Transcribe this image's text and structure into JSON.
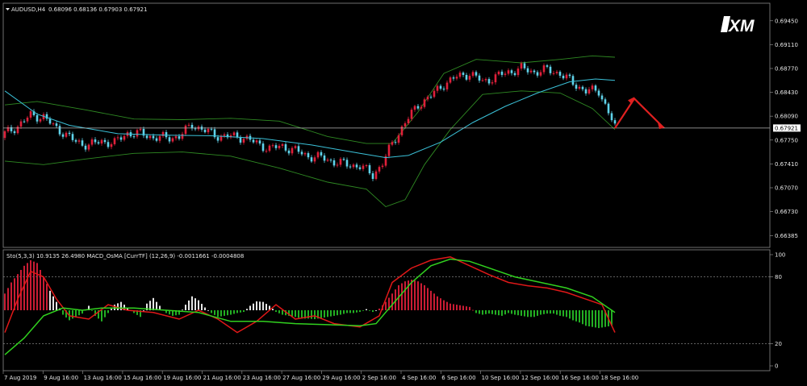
{
  "brand": {
    "logo_text": "XM"
  },
  "header": {
    "symbol_label": "AUDUSD,H4",
    "ohlc": "0.68096 0.68136 0.67903 0.67921"
  },
  "indicator_header": "Sto(5,3,3) 10.9135 26.4980  MACD_OsMA [CurrTF] (12,26,9) -0.0011661 -0.0004808",
  "colors": {
    "background": "#000000",
    "bull": "#e0203a",
    "bear": "#5fd2ea",
    "ma": "#3bc1d8",
    "bands": "#2f8a23",
    "arrow": "#e02020",
    "sto_main": "#e01818",
    "sto_signal": "#31d11f",
    "osma_pos": "#ffffff",
    "osma_neg": "#27c227"
  },
  "chart_data": [
    {
      "type": "candlestick",
      "title": "AUDUSD,H4",
      "ylim": [
        0.6622,
        0.697
      ],
      "y_ticks": [
        0.6945,
        0.6911,
        0.6877,
        0.6843,
        0.6809,
        0.6775,
        0.6741,
        0.6707,
        0.6673,
        0.66385
      ],
      "y_tick_labels": [
        "0.69450",
        "0.69110",
        "0.68770",
        "0.68430",
        "0.68090",
        "0.67750",
        "0.67410",
        "0.67070",
        "0.66730",
        "0.66385"
      ],
      "current_price": 0.67921,
      "current_price_label": "0.67921",
      "x_labels": [
        "7 Aug 2019",
        "9 Aug 16:00",
        "13 Aug 16:00",
        "15 Aug 16:00",
        "19 Aug 16:00",
        "21 Aug 16:00",
        "23 Aug 16:00",
        "27 Aug 16:00",
        "29 Aug 16:00",
        "2 Sep 16:00",
        "4 Sep 16:00",
        "6 Sep 16:00",
        "10 Sep 16:00",
        "12 Sep 16:00",
        "16 Sep 16:00",
        "18 Sep 16:00"
      ],
      "close_path": [
        [
          0,
          0.6784
        ],
        [
          4,
          0.6795
        ],
        [
          8,
          0.681
        ],
        [
          12,
          0.6808
        ],
        [
          15,
          0.6795
        ],
        [
          18,
          0.6786
        ],
        [
          22,
          0.6772
        ],
        [
          26,
          0.6768
        ],
        [
          30,
          0.6773
        ],
        [
          34,
          0.6771
        ],
        [
          38,
          0.6785
        ],
        [
          42,
          0.6784
        ],
        [
          46,
          0.6779
        ],
        [
          50,
          0.6778
        ],
        [
          54,
          0.678
        ],
        [
          58,
          0.6797
        ],
        [
          62,
          0.6788
        ],
        [
          66,
          0.6781
        ],
        [
          70,
          0.678
        ],
        [
          74,
          0.6779
        ],
        [
          78,
          0.677
        ],
        [
          82,
          0.6763
        ],
        [
          86,
          0.6766
        ],
        [
          90,
          0.676
        ],
        [
          94,
          0.6752
        ],
        [
          98,
          0.675
        ],
        [
          102,
          0.6744
        ],
        [
          106,
          0.674
        ],
        [
          110,
          0.6738
        ],
        [
          114,
          0.6725
        ],
        [
          117,
          0.6742
        ],
        [
          120,
          0.677
        ],
        [
          124,
          0.68
        ],
        [
          128,
          0.6825
        ],
        [
          132,
          0.6838
        ],
        [
          136,
          0.6855
        ],
        [
          140,
          0.6865
        ],
        [
          144,
          0.687
        ],
        [
          148,
          0.6858
        ],
        [
          152,
          0.6865
        ],
        [
          156,
          0.6872
        ],
        [
          160,
          0.6877
        ],
        [
          164,
          0.6872
        ],
        [
          168,
          0.6875
        ],
        [
          172,
          0.687
        ],
        [
          176,
          0.6856
        ],
        [
          180,
          0.6845
        ],
        [
          184,
          0.6845
        ],
        [
          187,
          0.6815
        ],
        [
          189,
          0.6792
        ]
      ],
      "moving_average": [
        [
          0,
          0.6845
        ],
        [
          10,
          0.6812
        ],
        [
          20,
          0.6796
        ],
        [
          35,
          0.6784
        ],
        [
          50,
          0.6782
        ],
        [
          65,
          0.6781
        ],
        [
          80,
          0.6777
        ],
        [
          95,
          0.6768
        ],
        [
          110,
          0.6756
        ],
        [
          118,
          0.675
        ],
        [
          125,
          0.6753
        ],
        [
          135,
          0.6772
        ],
        [
          145,
          0.68
        ],
        [
          155,
          0.6823
        ],
        [
          165,
          0.6842
        ],
        [
          175,
          0.6858
        ],
        [
          183,
          0.6862
        ],
        [
          189,
          0.686
        ]
      ],
      "upper_band": [
        [
          0,
          0.6825
        ],
        [
          10,
          0.683
        ],
        [
          25,
          0.6818
        ],
        [
          40,
          0.6805
        ],
        [
          55,
          0.6804
        ],
        [
          70,
          0.6806
        ],
        [
          85,
          0.6802
        ],
        [
          100,
          0.678
        ],
        [
          112,
          0.677
        ],
        [
          120,
          0.677
        ],
        [
          128,
          0.6815
        ],
        [
          136,
          0.687
        ],
        [
          146,
          0.689
        ],
        [
          160,
          0.6885
        ],
        [
          172,
          0.689
        ],
        [
          182,
          0.6895
        ],
        [
          189,
          0.6893
        ]
      ],
      "lower_band": [
        [
          0,
          0.6745
        ],
        [
          12,
          0.674
        ],
        [
          25,
          0.6748
        ],
        [
          40,
          0.6756
        ],
        [
          55,
          0.6758
        ],
        [
          70,
          0.6752
        ],
        [
          85,
          0.6735
        ],
        [
          100,
          0.6715
        ],
        [
          112,
          0.6705
        ],
        [
          118,
          0.668
        ],
        [
          124,
          0.669
        ],
        [
          130,
          0.674
        ],
        [
          138,
          0.679
        ],
        [
          148,
          0.684
        ],
        [
          160,
          0.6845
        ],
        [
          172,
          0.6842
        ],
        [
          182,
          0.682
        ],
        [
          189,
          0.679
        ]
      ],
      "forecast_arrow": [
        [
          189,
          0.6792
        ],
        [
          195,
          0.6834
        ],
        [
          204,
          0.6793
        ]
      ]
    },
    {
      "type": "oscillator",
      "title": "Sto(5,3,3) 10.9135 26.4980  MACD_OsMA [CurrTF] (12,26,9) -0.0011661 -0.0004808",
      "ylim": [
        0,
        100
      ],
      "y_tick_labels": [
        "100",
        "80",
        "20",
        "0"
      ],
      "levels": [
        80,
        20
      ],
      "stochastic_main": [
        [
          0,
          30
        ],
        [
          4,
          60
        ],
        [
          8,
          85
        ],
        [
          12,
          80
        ],
        [
          16,
          60
        ],
        [
          20,
          45
        ],
        [
          26,
          42
        ],
        [
          32,
          55
        ],
        [
          38,
          50
        ],
        [
          46,
          48
        ],
        [
          54,
          42
        ],
        [
          60,
          50
        ],
        [
          66,
          42
        ],
        [
          72,
          30
        ],
        [
          78,
          40
        ],
        [
          84,
          55
        ],
        [
          90,
          42
        ],
        [
          96,
          45
        ],
        [
          102,
          38
        ],
        [
          110,
          35
        ],
        [
          116,
          45
        ],
        [
          120,
          75
        ],
        [
          126,
          88
        ],
        [
          132,
          95
        ],
        [
          138,
          98
        ],
        [
          144,
          90
        ],
        [
          150,
          82
        ],
        [
          156,
          75
        ],
        [
          162,
          72
        ],
        [
          168,
          70
        ],
        [
          174,
          66
        ],
        [
          180,
          60
        ],
        [
          185,
          55
        ],
        [
          189,
          30
        ]
      ],
      "stochastic_signal": [
        [
          0,
          10
        ],
        [
          6,
          25
        ],
        [
          12,
          45
        ],
        [
          18,
          52
        ],
        [
          24,
          50
        ],
        [
          30,
          52
        ],
        [
          40,
          52
        ],
        [
          50,
          50
        ],
        [
          60,
          48
        ],
        [
          70,
          40
        ],
        [
          80,
          40
        ],
        [
          90,
          38
        ],
        [
          100,
          37
        ],
        [
          110,
          36
        ],
        [
          115,
          38
        ],
        [
          120,
          55
        ],
        [
          126,
          75
        ],
        [
          132,
          90
        ],
        [
          138,
          96
        ],
        [
          144,
          94
        ],
        [
          150,
          88
        ],
        [
          158,
          80
        ],
        [
          166,
          75
        ],
        [
          174,
          70
        ],
        [
          182,
          62
        ],
        [
          189,
          48
        ]
      ],
      "osma_histogram": [
        [
          0,
          30
        ],
        [
          2,
          50
        ],
        [
          4,
          65
        ],
        [
          6,
          80
        ],
        [
          8,
          90
        ],
        [
          10,
          85
        ],
        [
          12,
          60
        ],
        [
          14,
          35
        ],
        [
          16,
          15
        ],
        [
          18,
          -8
        ],
        [
          20,
          -18
        ],
        [
          22,
          -12
        ],
        [
          24,
          -6
        ],
        [
          26,
          8
        ],
        [
          28,
          -10
        ],
        [
          30,
          -20
        ],
        [
          32,
          -5
        ],
        [
          34,
          10
        ],
        [
          36,
          15
        ],
        [
          38,
          5
        ],
        [
          40,
          -5
        ],
        [
          42,
          -12
        ],
        [
          44,
          12
        ],
        [
          46,
          22
        ],
        [
          48,
          8
        ],
        [
          50,
          -5
        ],
        [
          52,
          -10
        ],
        [
          54,
          -8
        ],
        [
          56,
          10
        ],
        [
          58,
          25
        ],
        [
          60,
          18
        ],
        [
          62,
          5
        ],
        [
          64,
          -5
        ],
        [
          66,
          -12
        ],
        [
          68,
          -10
        ],
        [
          70,
          -8
        ],
        [
          72,
          -5
        ],
        [
          74,
          -3
        ],
        [
          76,
          8
        ],
        [
          78,
          16
        ],
        [
          80,
          15
        ],
        [
          82,
          8
        ],
        [
          84,
          -3
        ],
        [
          86,
          -8
        ],
        [
          88,
          -10
        ],
        [
          90,
          -12
        ],
        [
          92,
          -15
        ],
        [
          94,
          -15
        ],
        [
          96,
          -16
        ],
        [
          98,
          -14
        ],
        [
          100,
          -12
        ],
        [
          102,
          -10
        ],
        [
          104,
          -8
        ],
        [
          106,
          -5
        ],
        [
          108,
          -5
        ],
        [
          110,
          -3
        ],
        [
          112,
          2
        ],
        [
          114,
          -3
        ],
        [
          116,
          3
        ],
        [
          118,
          15
        ],
        [
          120,
          30
        ],
        [
          122,
          45
        ],
        [
          124,
          52
        ],
        [
          126,
          55
        ],
        [
          128,
          52
        ],
        [
          130,
          45
        ],
        [
          132,
          35
        ],
        [
          134,
          25
        ],
        [
          136,
          18
        ],
        [
          138,
          12
        ],
        [
          140,
          10
        ],
        [
          142,
          8
        ],
        [
          144,
          6
        ],
        [
          146,
          -5
        ],
        [
          148,
          -8
        ],
        [
          150,
          -6
        ],
        [
          152,
          -8
        ],
        [
          154,
          -10
        ],
        [
          156,
          -5
        ],
        [
          158,
          -8
        ],
        [
          160,
          -10
        ],
        [
          162,
          -12
        ],
        [
          164,
          -12
        ],
        [
          166,
          -8
        ],
        [
          168,
          -6
        ],
        [
          170,
          -6
        ],
        [
          172,
          -10
        ],
        [
          174,
          -12
        ],
        [
          176,
          -18
        ],
        [
          178,
          -22
        ],
        [
          180,
          -28
        ],
        [
          182,
          -30
        ],
        [
          184,
          -32
        ],
        [
          186,
          -30
        ],
        [
          188,
          -28
        ]
      ]
    }
  ]
}
